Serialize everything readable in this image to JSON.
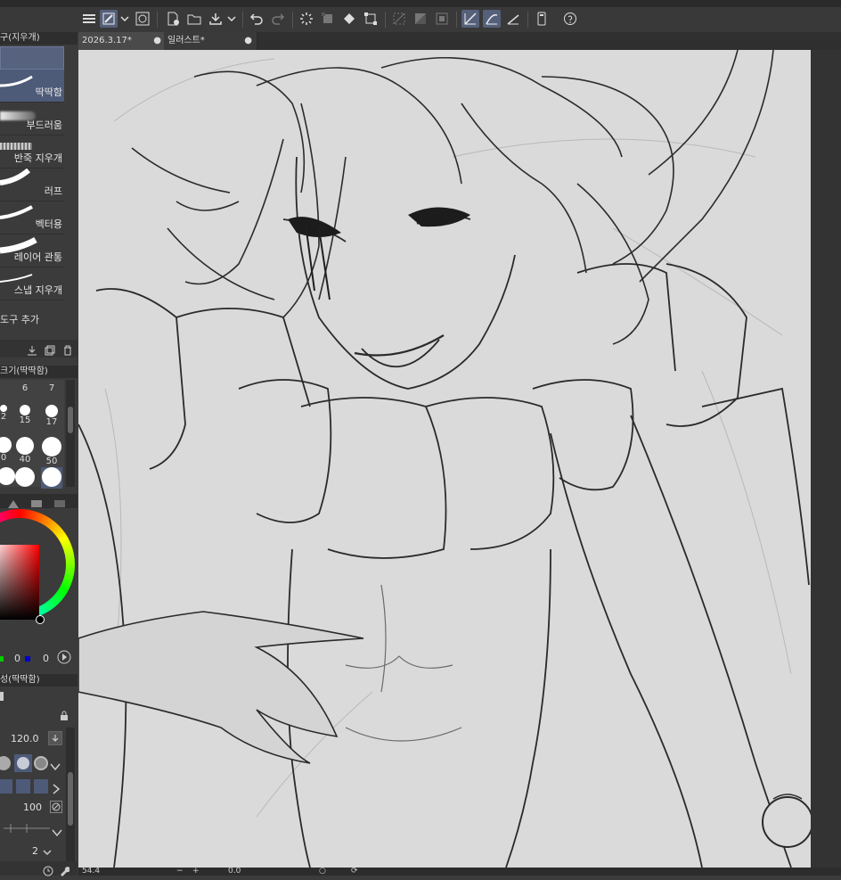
{
  "toolbar": {
    "icons": [
      "menu-icon",
      "brush-tool-icon",
      "dropdown-icon",
      "lasso-icon",
      "new-file-icon",
      "open-file-icon",
      "save-icon",
      "undo-icon",
      "redo-icon",
      "loading-icon",
      "transform-icon",
      "fill-icon",
      "select-transform-icon",
      "hide-selection-icon",
      "invert-selection-icon",
      "clear-selection-icon",
      "snap-ruler-icon",
      "snap-special-ruler-icon",
      "snap-grid-icon",
      "smartphone-icon",
      "help-icon"
    ]
  },
  "left": {
    "subtool_header": "구(지우개)",
    "subtools": [
      {
        "label": "딱딱함"
      },
      {
        "label": "부드러움"
      },
      {
        "label": "반죽 지우개"
      },
      {
        "label": "러프"
      },
      {
        "label": "벡터용"
      },
      {
        "label": "레이어 관통"
      },
      {
        "label": "스냅 지우개"
      }
    ],
    "add_tool": "도구 추가",
    "brush_size_header": "크기(딱딱함)",
    "brush_sizes": {
      "row1": [
        "6",
        "7"
      ],
      "row2": [
        "2",
        "15",
        "17"
      ],
      "row3": [
        "0",
        "40",
        "50"
      ]
    },
    "color_values": [
      "0",
      "0"
    ],
    "property_header": "성(딱딱함)",
    "size_value": "120.0",
    "opacity_value": "100",
    "blend_value": "2"
  },
  "tabs": [
    {
      "label": "2026.3.17*"
    },
    {
      "label": "일러스트*"
    }
  ],
  "status": {
    "zoom": "54.4",
    "angle": "0.0"
  },
  "colors": {
    "accent": "#4d5a78",
    "panel": "#3b3b3b",
    "canvas": "#d9d9d9"
  }
}
